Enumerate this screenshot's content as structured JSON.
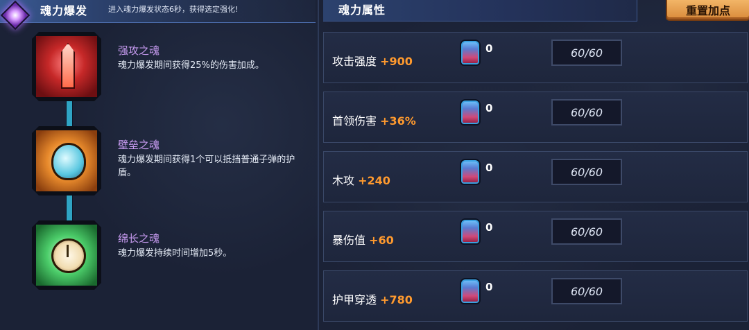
{
  "header": {
    "left_title": "魂力爆发",
    "left_desc": "进入魂力爆发状态6秒，获得选定强化!",
    "right_title": "魂力属性",
    "reset_label": "重置加点"
  },
  "skills": [
    {
      "name": "强攻之魂",
      "desc": "魂力爆发期间获得25%的伤害加成。",
      "icon": "red-sword-icon"
    },
    {
      "name": "壁垒之魂",
      "desc": "魂力爆发期间获得1个可以抵挡普通子弹的护盾。",
      "icon": "shield-icon"
    },
    {
      "name": "绵长之魂",
      "desc": "魂力爆发持续时间增加5秒。",
      "icon": "clock-icon"
    }
  ],
  "stats": [
    {
      "label": "攻击强度",
      "bonus": "+900",
      "potion_count": "0",
      "level": "60/60"
    },
    {
      "label": "首领伤害",
      "bonus": "+36%",
      "potion_count": "0",
      "level": "60/60"
    },
    {
      "label": "木攻",
      "bonus": "+240",
      "potion_count": "0",
      "level": "60/60"
    },
    {
      "label": "暴伤值",
      "bonus": "+60",
      "potion_count": "0",
      "level": "60/60"
    },
    {
      "label": "护甲穿透",
      "bonus": "+780",
      "potion_count": "0",
      "level": "60/60"
    }
  ],
  "colors": {
    "accent_orange": "#ff9a2e",
    "skill_name_purple": "#c79bf0",
    "connector_teal": "#2fa4c4"
  }
}
